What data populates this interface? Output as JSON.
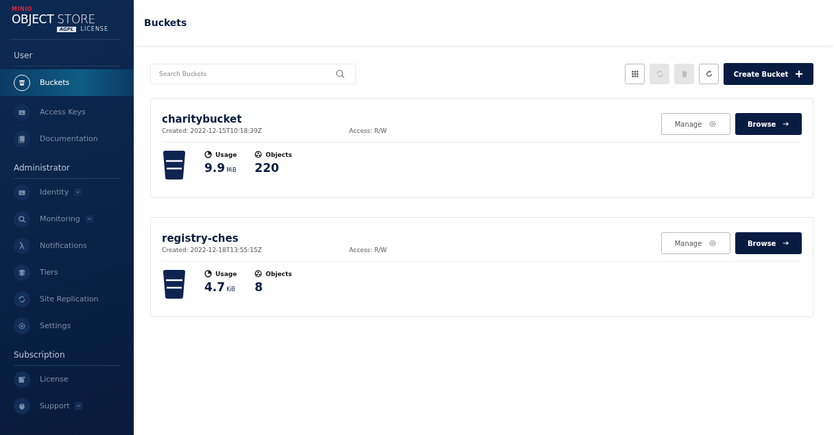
{
  "logo": {
    "brand": "MINIO",
    "product": "**OBJECT** STORE",
    "badge": "AGPL",
    "license": "LICENSE"
  },
  "sidebar": {
    "sections": [
      {
        "title": "User",
        "items": [
          {
            "label": "Buckets",
            "selected": true,
            "expandable": false
          },
          {
            "label": "Access Keys",
            "selected": false,
            "expandable": false
          },
          {
            "label": "Documentation",
            "selected": false,
            "expandable": false
          }
        ]
      },
      {
        "title": "Administrator",
        "items": [
          {
            "label": "Identity",
            "selected": false,
            "expandable": true
          },
          {
            "label": "Monitoring",
            "selected": false,
            "expandable": true
          },
          {
            "label": "Notifications",
            "selected": false,
            "expandable": false
          },
          {
            "label": "Tiers",
            "selected": false,
            "expandable": false
          },
          {
            "label": "Site Replication",
            "selected": false,
            "expandable": false
          },
          {
            "label": "Settings",
            "selected": false,
            "expandable": false
          }
        ]
      },
      {
        "title": "Subscription",
        "items": [
          {
            "label": "License",
            "selected": false,
            "expandable": false
          },
          {
            "label": "Support",
            "selected": false,
            "expandable": true
          }
        ]
      }
    ]
  },
  "header": {
    "title": "Buckets"
  },
  "search": {
    "placeholder": "Search Buckets"
  },
  "toolbar": [
    {
      "disabled": false
    },
    {
      "disabled": true
    },
    {
      "disabled": true
    },
    {
      "disabled": false
    }
  ],
  "create_button": {
    "label": "Create Bucket"
  },
  "buckets": [
    {
      "name": "charitybucket",
      "created": "Created: 2022-12-15T10:18:39Z",
      "access": "Access: R/W",
      "usage_label": "Usage",
      "usage_value": "9.9",
      "usage_unit": "MiB",
      "objects_label": "Objects",
      "objects_value": "220",
      "manage": "Manage",
      "browse": "Browse"
    },
    {
      "name": "registry-ches",
      "created": "Created: 2022-12-18T13:55:15Z",
      "access": "Access: R/W",
      "usage_label": "Usage",
      "usage_value": "4.7",
      "usage_unit": "KiB",
      "objects_label": "Objects",
      "objects_value": "8",
      "manage": "Manage",
      "browse": "Browse"
    }
  ]
}
